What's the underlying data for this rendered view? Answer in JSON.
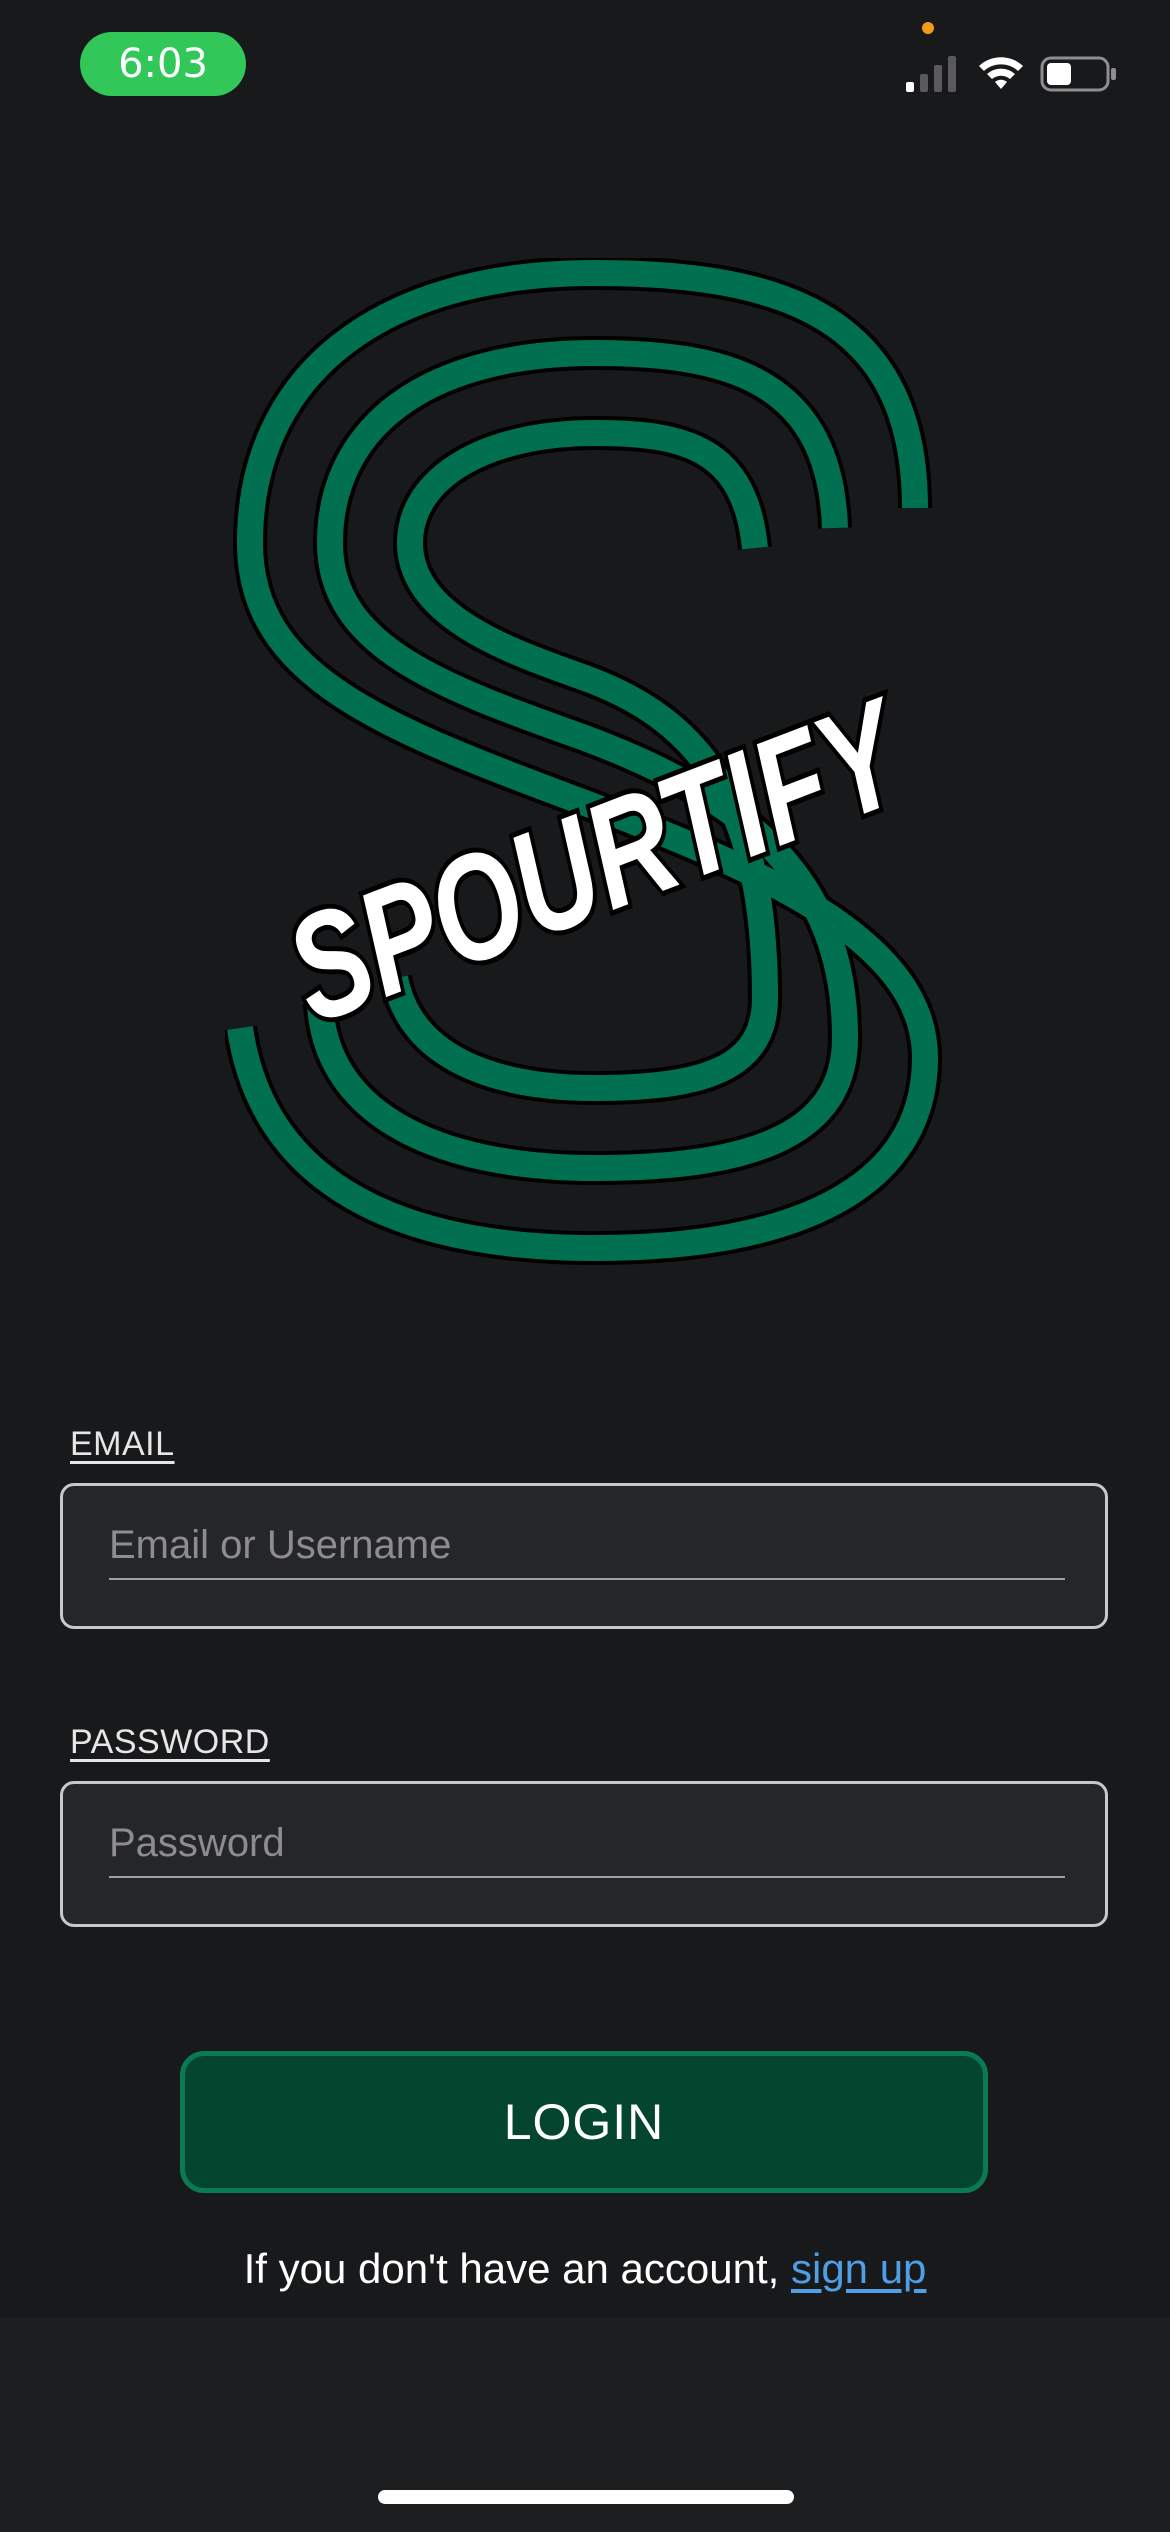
{
  "status_bar": {
    "time": "6:03",
    "icons": [
      "signal-icon",
      "wifi-icon",
      "battery-icon"
    ],
    "time_pill_color": "#32c759",
    "privacy_dot_color": "#f29a1e"
  },
  "logo": {
    "wordmark": "SPOURTIFY",
    "colors": {
      "stripe": "#007050",
      "outline": "#000000",
      "wordmark_fill": "#ffffff"
    }
  },
  "form": {
    "email": {
      "label": "EMAIL",
      "placeholder": "Email or Username",
      "value": ""
    },
    "password": {
      "label": "PASSWORD",
      "placeholder": "Password",
      "value": ""
    },
    "login_label": "LOGIN"
  },
  "signup": {
    "prefix": "If you don't have an account, ",
    "link_label": "sign up"
  },
  "colors": {
    "background": "#18191b",
    "field_background": "#252628",
    "button_fill": "#03452f",
    "button_border": "#0a7a55",
    "link": "#4f9fe6"
  }
}
